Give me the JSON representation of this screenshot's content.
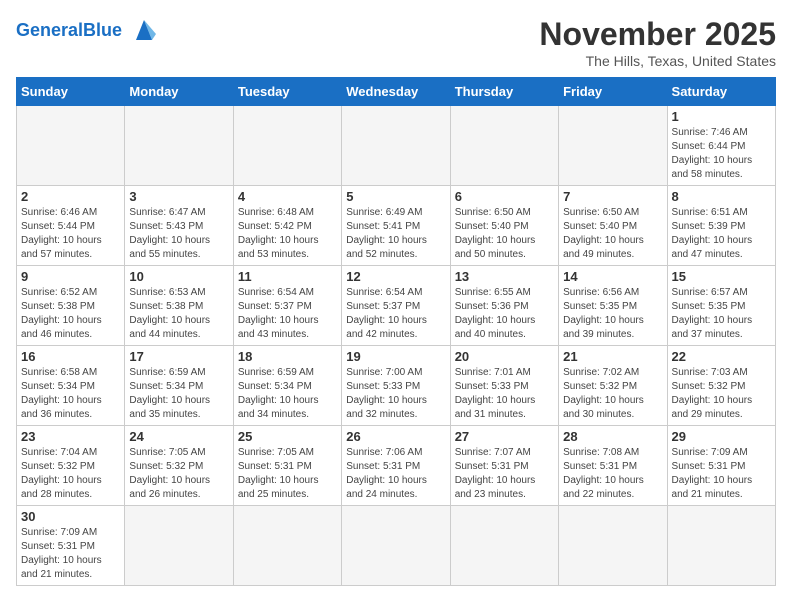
{
  "header": {
    "logo_general": "General",
    "logo_blue": "Blue",
    "month_title": "November 2025",
    "location": "The Hills, Texas, United States"
  },
  "days_of_week": [
    "Sunday",
    "Monday",
    "Tuesday",
    "Wednesday",
    "Thursday",
    "Friday",
    "Saturday"
  ],
  "weeks": [
    [
      {
        "day": "",
        "info": ""
      },
      {
        "day": "",
        "info": ""
      },
      {
        "day": "",
        "info": ""
      },
      {
        "day": "",
        "info": ""
      },
      {
        "day": "",
        "info": ""
      },
      {
        "day": "",
        "info": ""
      },
      {
        "day": "1",
        "info": "Sunrise: 7:46 AM\nSunset: 6:44 PM\nDaylight: 10 hours\nand 58 minutes."
      }
    ],
    [
      {
        "day": "2",
        "info": "Sunrise: 6:46 AM\nSunset: 5:44 PM\nDaylight: 10 hours\nand 57 minutes."
      },
      {
        "day": "3",
        "info": "Sunrise: 6:47 AM\nSunset: 5:43 PM\nDaylight: 10 hours\nand 55 minutes."
      },
      {
        "day": "4",
        "info": "Sunrise: 6:48 AM\nSunset: 5:42 PM\nDaylight: 10 hours\nand 53 minutes."
      },
      {
        "day": "5",
        "info": "Sunrise: 6:49 AM\nSunset: 5:41 PM\nDaylight: 10 hours\nand 52 minutes."
      },
      {
        "day": "6",
        "info": "Sunrise: 6:50 AM\nSunset: 5:40 PM\nDaylight: 10 hours\nand 50 minutes."
      },
      {
        "day": "7",
        "info": "Sunrise: 6:50 AM\nSunset: 5:40 PM\nDaylight: 10 hours\nand 49 minutes."
      },
      {
        "day": "8",
        "info": "Sunrise: 6:51 AM\nSunset: 5:39 PM\nDaylight: 10 hours\nand 47 minutes."
      }
    ],
    [
      {
        "day": "9",
        "info": "Sunrise: 6:52 AM\nSunset: 5:38 PM\nDaylight: 10 hours\nand 46 minutes."
      },
      {
        "day": "10",
        "info": "Sunrise: 6:53 AM\nSunset: 5:38 PM\nDaylight: 10 hours\nand 44 minutes."
      },
      {
        "day": "11",
        "info": "Sunrise: 6:54 AM\nSunset: 5:37 PM\nDaylight: 10 hours\nand 43 minutes."
      },
      {
        "day": "12",
        "info": "Sunrise: 6:54 AM\nSunset: 5:37 PM\nDaylight: 10 hours\nand 42 minutes."
      },
      {
        "day": "13",
        "info": "Sunrise: 6:55 AM\nSunset: 5:36 PM\nDaylight: 10 hours\nand 40 minutes."
      },
      {
        "day": "14",
        "info": "Sunrise: 6:56 AM\nSunset: 5:35 PM\nDaylight: 10 hours\nand 39 minutes."
      },
      {
        "day": "15",
        "info": "Sunrise: 6:57 AM\nSunset: 5:35 PM\nDaylight: 10 hours\nand 37 minutes."
      }
    ],
    [
      {
        "day": "16",
        "info": "Sunrise: 6:58 AM\nSunset: 5:34 PM\nDaylight: 10 hours\nand 36 minutes."
      },
      {
        "day": "17",
        "info": "Sunrise: 6:59 AM\nSunset: 5:34 PM\nDaylight: 10 hours\nand 35 minutes."
      },
      {
        "day": "18",
        "info": "Sunrise: 6:59 AM\nSunset: 5:34 PM\nDaylight: 10 hours\nand 34 minutes."
      },
      {
        "day": "19",
        "info": "Sunrise: 7:00 AM\nSunset: 5:33 PM\nDaylight: 10 hours\nand 32 minutes."
      },
      {
        "day": "20",
        "info": "Sunrise: 7:01 AM\nSunset: 5:33 PM\nDaylight: 10 hours\nand 31 minutes."
      },
      {
        "day": "21",
        "info": "Sunrise: 7:02 AM\nSunset: 5:32 PM\nDaylight: 10 hours\nand 30 minutes."
      },
      {
        "day": "22",
        "info": "Sunrise: 7:03 AM\nSunset: 5:32 PM\nDaylight: 10 hours\nand 29 minutes."
      }
    ],
    [
      {
        "day": "23",
        "info": "Sunrise: 7:04 AM\nSunset: 5:32 PM\nDaylight: 10 hours\nand 28 minutes."
      },
      {
        "day": "24",
        "info": "Sunrise: 7:05 AM\nSunset: 5:32 PM\nDaylight: 10 hours\nand 26 minutes."
      },
      {
        "day": "25",
        "info": "Sunrise: 7:05 AM\nSunset: 5:31 PM\nDaylight: 10 hours\nand 25 minutes."
      },
      {
        "day": "26",
        "info": "Sunrise: 7:06 AM\nSunset: 5:31 PM\nDaylight: 10 hours\nand 24 minutes."
      },
      {
        "day": "27",
        "info": "Sunrise: 7:07 AM\nSunset: 5:31 PM\nDaylight: 10 hours\nand 23 minutes."
      },
      {
        "day": "28",
        "info": "Sunrise: 7:08 AM\nSunset: 5:31 PM\nDaylight: 10 hours\nand 22 minutes."
      },
      {
        "day": "29",
        "info": "Sunrise: 7:09 AM\nSunset: 5:31 PM\nDaylight: 10 hours\nand 21 minutes."
      }
    ],
    [
      {
        "day": "30",
        "info": "Sunrise: 7:09 AM\nSunset: 5:31 PM\nDaylight: 10 hours\nand 21 minutes."
      },
      {
        "day": "",
        "info": ""
      },
      {
        "day": "",
        "info": ""
      },
      {
        "day": "",
        "info": ""
      },
      {
        "day": "",
        "info": ""
      },
      {
        "day": "",
        "info": ""
      },
      {
        "day": "",
        "info": ""
      }
    ]
  ]
}
